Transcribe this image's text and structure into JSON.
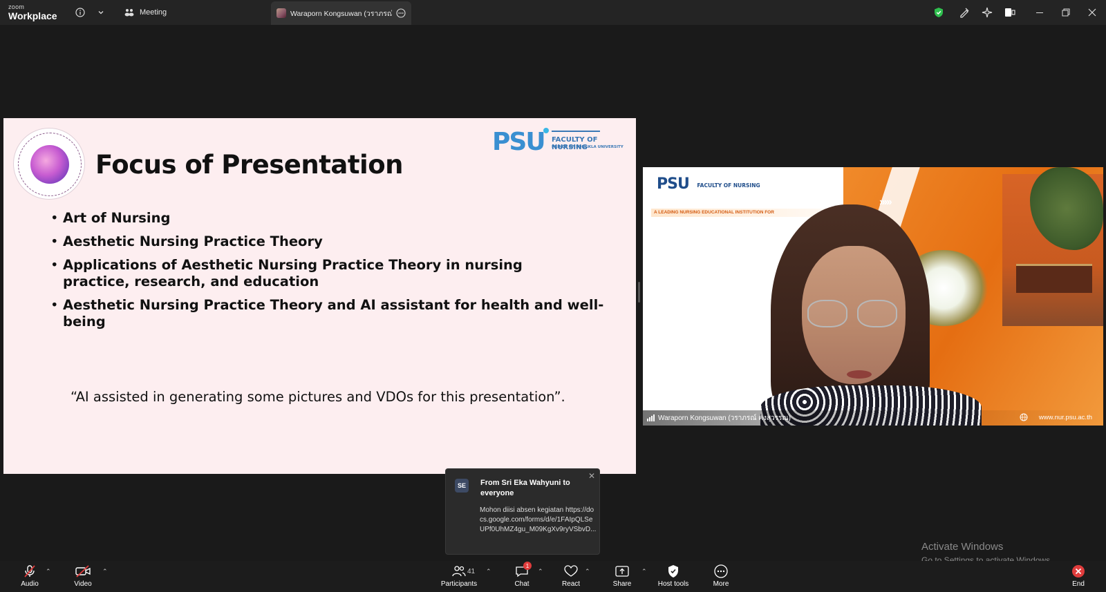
{
  "titlebar": {
    "logo_small": "zoom",
    "logo_big": "Workplace",
    "meeting_tab": "Meeting",
    "active_tab": "Waraporn Kongsuwan (วราภรณ์ คง"
  },
  "slide": {
    "title": "Focus of Presentation",
    "psu_logo_text": "PSU",
    "faculty_line1": "FACULTY OF NURSING",
    "faculty_line2": "PRINCE OF SONGKLA UNIVERSITY",
    "bullets": [
      "Art of Nursing",
      "Aesthetic Nursing Practice Theory",
      "Applications of Aesthetic Nursing Practice Theory in nursing practice, research, and education",
      "Aesthetic Nursing Practice Theory and AI assistant for health and well-being"
    ],
    "quote": "“AI assisted in generating some pictures and VDOs for this presentation”."
  },
  "video": {
    "participant_name": "Waraporn Kongsuwan (วราภรณ์ คงสุวรรณ)",
    "url": "www.nur.psu.ac.th",
    "psu_text": "PSU",
    "faculty_text": "FACULTY OF NURSING",
    "tagline": "A LEADING NURSING EDUCATIONAL INSTITUTION FOR"
  },
  "chat_toast": {
    "avatar": "SE",
    "from": "From Sri Eka Wahyuni to everyone",
    "message": "Mohon diisi absen kegiatan https://docs.google.com/forms/d/e/1FAIpQLSeUPf0UhMZ4gu_M09KgXv9ryVSbvD..."
  },
  "watermark": {
    "line1": "Activate Windows",
    "line2": "Go to Settings to activate Windows."
  },
  "toolbar": {
    "audio": "Audio",
    "video": "Video",
    "participants": "Participants",
    "participant_count": "41",
    "chat": "Chat",
    "chat_badge": "1",
    "react": "React",
    "share": "Share",
    "host_tools": "Host tools",
    "more": "More",
    "end": "End"
  },
  "colors": {
    "accent_green": "#2fbf4e",
    "end_red": "#e03c3c",
    "slide_bg": "#fdeef0",
    "psu_blue": "#3a78b5"
  }
}
